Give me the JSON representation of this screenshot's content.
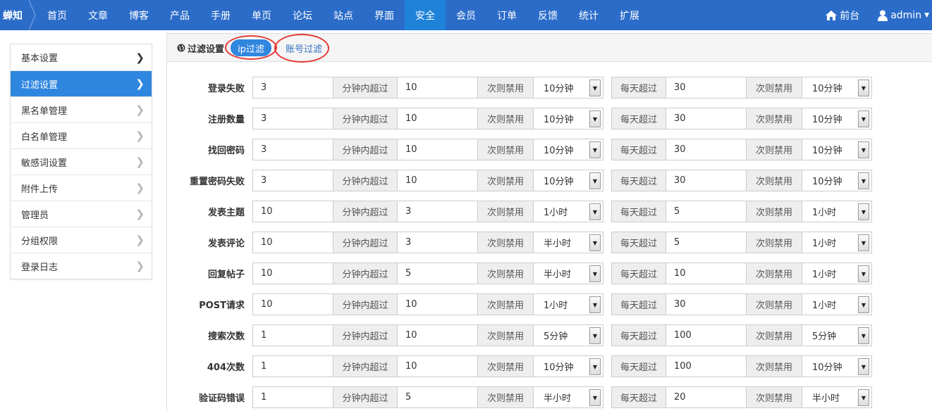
{
  "nav": {
    "brand": "蝉知",
    "items": [
      "首页",
      "文章",
      "博客",
      "产品",
      "手册",
      "单页",
      "论坛",
      "站点",
      "界面",
      "安全",
      "会员",
      "订单",
      "反馈",
      "统计",
      "扩展"
    ],
    "active_index": 9,
    "front": "前台",
    "user": "admin"
  },
  "sidebar": {
    "items": [
      "基本设置",
      "过滤设置",
      "黑名单管理",
      "白名单管理",
      "敏感词设置",
      "附件上传",
      "管理员",
      "分组权限",
      "登录日志"
    ],
    "active_index": 1
  },
  "panel": {
    "title": "过滤设置",
    "tab_ip": "ip过滤",
    "tab_account": "账号过滤"
  },
  "labels": {
    "minutes_over": "分钟内超过",
    "then_ban": "次则禁用",
    "daily_over": "每天超过"
  },
  "rows": [
    {
      "label": "登录失败",
      "minutes": "3",
      "times": "10",
      "ban1": "10分钟",
      "daily": "30",
      "ban2": "10分钟"
    },
    {
      "label": "注册数量",
      "minutes": "3",
      "times": "10",
      "ban1": "10分钟",
      "daily": "30",
      "ban2": "10分钟"
    },
    {
      "label": "找回密码",
      "minutes": "3",
      "times": "10",
      "ban1": "10分钟",
      "daily": "30",
      "ban2": "10分钟"
    },
    {
      "label": "重置密码失败",
      "minutes": "3",
      "times": "10",
      "ban1": "10分钟",
      "daily": "30",
      "ban2": "10分钟"
    },
    {
      "label": "发表主题",
      "minutes": "10",
      "times": "3",
      "ban1": "1小时",
      "daily": "5",
      "ban2": "1小时"
    },
    {
      "label": "发表评论",
      "minutes": "10",
      "times": "3",
      "ban1": "半小时",
      "daily": "5",
      "ban2": "1小时"
    },
    {
      "label": "回复帖子",
      "minutes": "10",
      "times": "5",
      "ban1": "半小时",
      "daily": "10",
      "ban2": "1小时"
    },
    {
      "label": "POST请求",
      "minutes": "10",
      "times": "10",
      "ban1": "1小时",
      "daily": "30",
      "ban2": "1小时"
    },
    {
      "label": "搜索次数",
      "minutes": "1",
      "times": "10",
      "ban1": "5分钟",
      "daily": "100",
      "ban2": "5分钟"
    },
    {
      "label": "404次数",
      "minutes": "1",
      "times": "10",
      "ban1": "10分钟",
      "daily": "100",
      "ban2": "10分钟"
    },
    {
      "label": "验证码错误",
      "minutes": "1",
      "times": "5",
      "ban1": "半小时",
      "daily": "20",
      "ban2": "半小时"
    }
  ]
}
